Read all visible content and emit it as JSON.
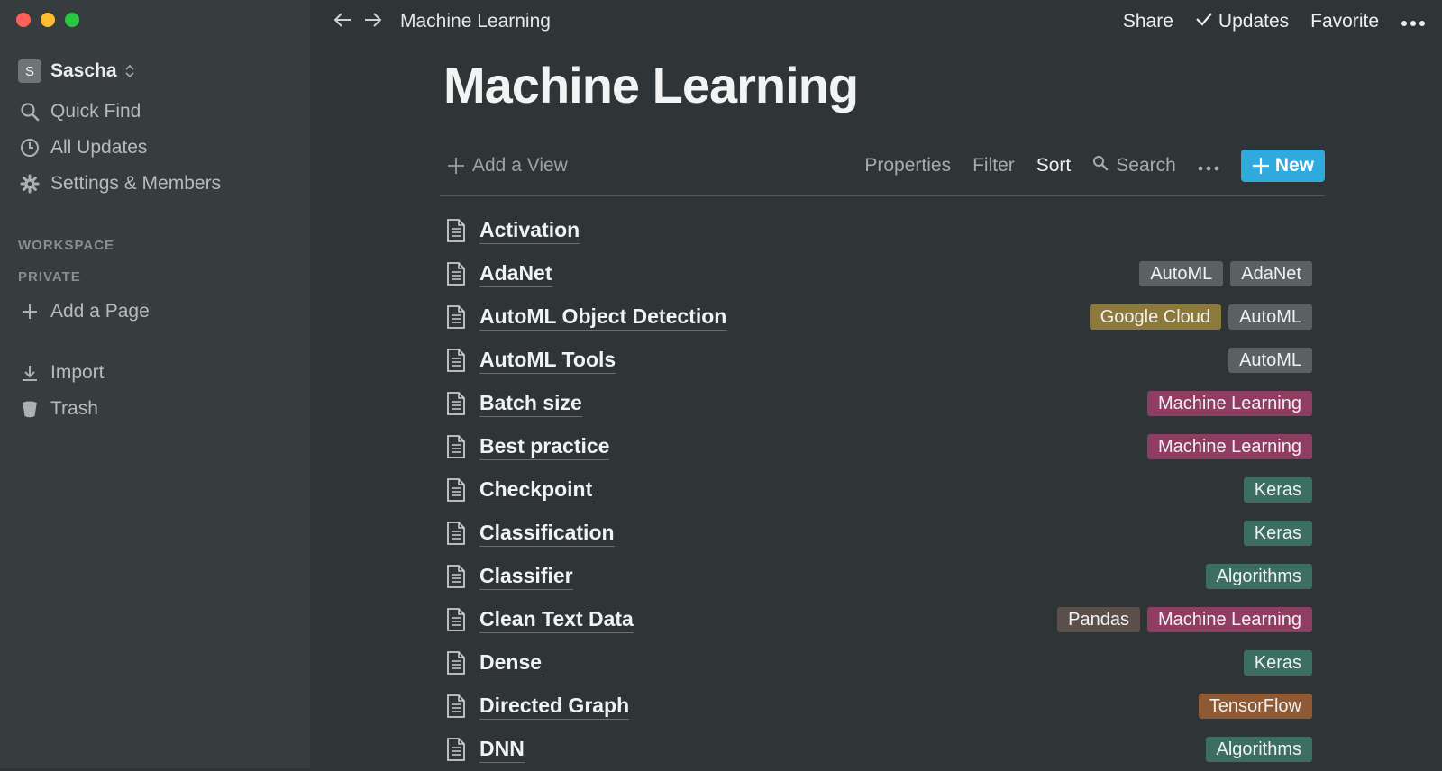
{
  "window": {
    "breadcrumb": "Machine Learning"
  },
  "sidebar": {
    "workspace_initial": "S",
    "workspace_name": "Sascha",
    "nav": [
      {
        "label": "Quick Find",
        "icon": "search-icon"
      },
      {
        "label": "All Updates",
        "icon": "clock-icon"
      },
      {
        "label": "Settings & Members",
        "icon": "gear-icon"
      }
    ],
    "section_workspace": "WORKSPACE",
    "section_private": "PRIVATE",
    "add_page": "Add a Page",
    "import": "Import",
    "trash": "Trash"
  },
  "topbar": {
    "share": "Share",
    "updates": "Updates",
    "favorite": "Favorite"
  },
  "page": {
    "title": "Machine Learning"
  },
  "viewbar": {
    "add_view": "Add a View",
    "properties": "Properties",
    "filter": "Filter",
    "sort": "Sort",
    "search": "Search",
    "new": "New"
  },
  "colors": {
    "gray": "#5b6063",
    "yellow": "#8c7a3c",
    "pink": "#8f3d63",
    "green": "#3c6e61",
    "brown": "#5b4f4a",
    "orange": "#8e5a35",
    "accent": "#2eaadc"
  },
  "rows": [
    {
      "title": "Activation",
      "tags": []
    },
    {
      "title": "AdaNet",
      "tags": [
        {
          "label": "AutoML",
          "color": "gray"
        },
        {
          "label": "AdaNet",
          "color": "gray"
        }
      ]
    },
    {
      "title": "AutoML Object Detection",
      "tags": [
        {
          "label": "Google Cloud",
          "color": "yellow"
        },
        {
          "label": "AutoML",
          "color": "gray"
        }
      ]
    },
    {
      "title": "AutoML Tools",
      "tags": [
        {
          "label": "AutoML",
          "color": "gray"
        }
      ]
    },
    {
      "title": "Batch size",
      "tags": [
        {
          "label": "Machine Learning",
          "color": "pink"
        }
      ]
    },
    {
      "title": "Best practice",
      "tags": [
        {
          "label": "Machine Learning",
          "color": "pink"
        }
      ]
    },
    {
      "title": "Checkpoint",
      "tags": [
        {
          "label": "Keras",
          "color": "green"
        }
      ]
    },
    {
      "title": "Classification",
      "tags": [
        {
          "label": "Keras",
          "color": "green"
        }
      ]
    },
    {
      "title": "Classifier",
      "tags": [
        {
          "label": "Algorithms",
          "color": "green"
        }
      ]
    },
    {
      "title": "Clean Text Data",
      "tags": [
        {
          "label": "Pandas",
          "color": "brown"
        },
        {
          "label": "Machine Learning",
          "color": "pink"
        }
      ]
    },
    {
      "title": "Dense",
      "tags": [
        {
          "label": "Keras",
          "color": "green"
        }
      ]
    },
    {
      "title": "Directed Graph",
      "tags": [
        {
          "label": "TensorFlow",
          "color": "orange"
        }
      ]
    },
    {
      "title": "DNN",
      "tags": [
        {
          "label": "Algorithms",
          "color": "green"
        }
      ]
    }
  ]
}
